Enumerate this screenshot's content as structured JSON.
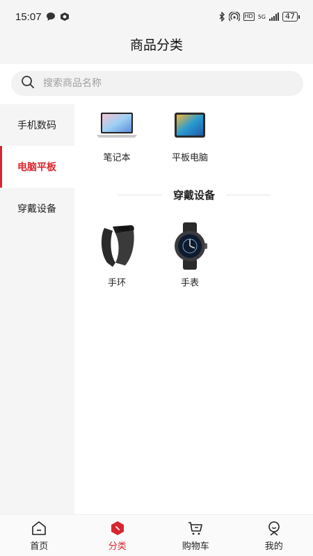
{
  "status_bar": {
    "time": "15:07",
    "net_label": "5G",
    "battery": "47"
  },
  "header": {
    "title": "商品分类"
  },
  "search": {
    "placeholder": "搜索商品名称"
  },
  "sidebar": {
    "items": [
      {
        "label": "手机数码",
        "active": false
      },
      {
        "label": "电脑平板",
        "active": true
      },
      {
        "label": "穿戴设备",
        "active": false
      }
    ]
  },
  "content": {
    "computers": [
      {
        "label": "笔记本",
        "icon": "laptop-icon"
      },
      {
        "label": "平板电脑",
        "icon": "tablet-icon"
      }
    ],
    "wearables_title": "穿戴设备",
    "wearables": [
      {
        "label": "手环",
        "icon": "band-icon"
      },
      {
        "label": "手表",
        "icon": "watch-icon"
      }
    ]
  },
  "tabbar": {
    "items": [
      {
        "label": "首页",
        "icon": "home-icon",
        "active": false
      },
      {
        "label": "分类",
        "icon": "category-icon",
        "active": true
      },
      {
        "label": "购物车",
        "icon": "cart-icon",
        "active": false
      },
      {
        "label": "我的",
        "icon": "profile-icon",
        "active": false
      }
    ]
  },
  "colors": {
    "accent": "#d8262f",
    "background": "#f5f5f5"
  }
}
